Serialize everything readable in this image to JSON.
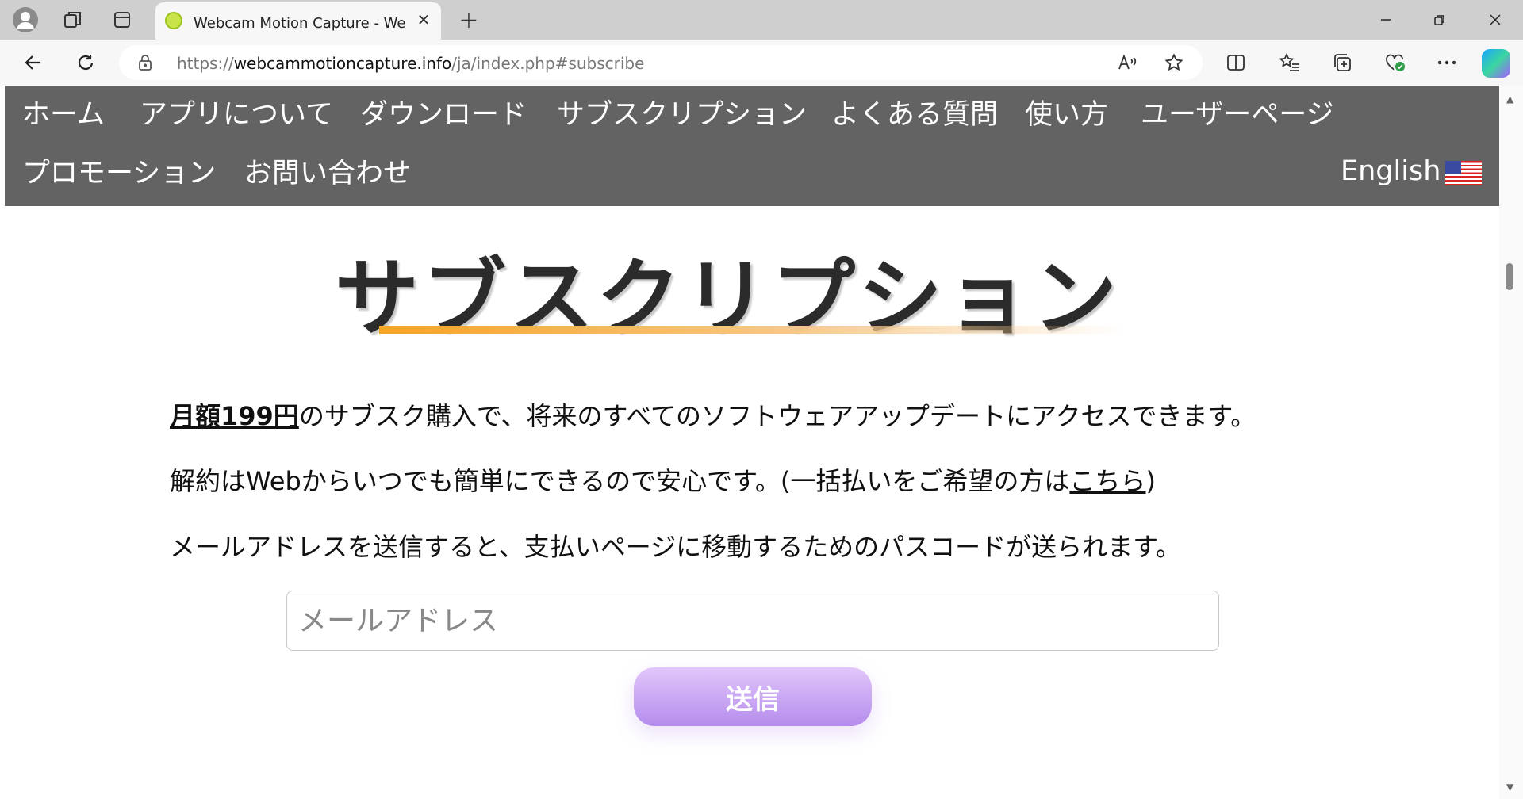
{
  "browser": {
    "tab": {
      "title": "Webcam Motion Capture - Webカメラ"
    },
    "new_tab_symbol": "+",
    "address": {
      "scheme": "https://",
      "host": "webcammotioncapture.info",
      "path": "/ja/index.php#subscribe"
    }
  },
  "site_nav": {
    "items": [
      "ホーム",
      "アプリについて",
      "ダウンロード",
      "サブスクリプション",
      "よくある質問",
      "使い方",
      "ユーザーページ",
      "プロモーション",
      "お問い合わせ"
    ],
    "language": "English"
  },
  "main": {
    "title": "サブスクリプション",
    "p1": {
      "price": "月額199円",
      "text": "のサブスク購入で、将来のすべてのソフトウェアアップデートにアクセスできます。"
    },
    "p2": {
      "text": "解約はWebからいつでも簡単にできるので安心です。(一括払いをご希望の方は",
      "link": "こちら",
      "end": ")"
    },
    "p3": "メールアドレスを送信すると、支払いページに移動するためのパスコードが送られます。",
    "email_placeholder": "メールアドレス",
    "submit": "送信"
  },
  "colors": {
    "nav_bg": "#636363",
    "accent": "#f2a524",
    "button": "#b58cec"
  }
}
